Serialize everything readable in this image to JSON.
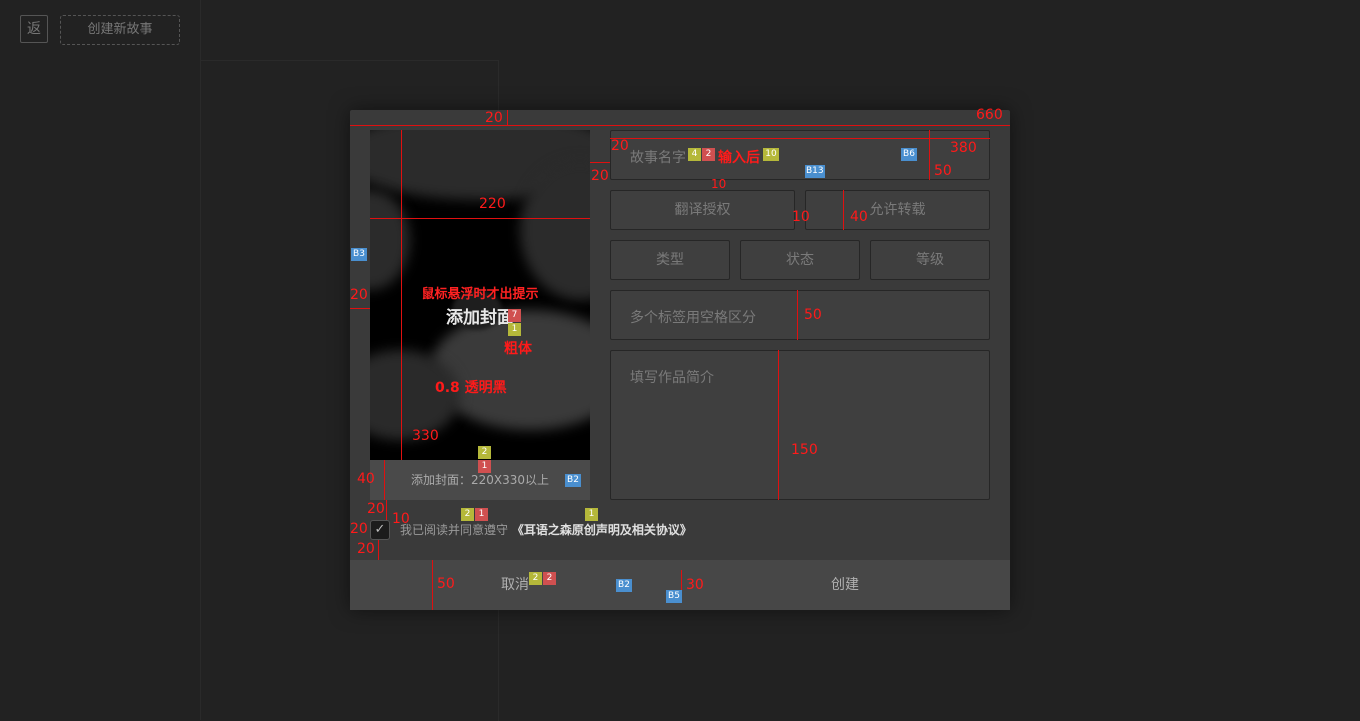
{
  "background": {
    "back_label": "返",
    "create_story_label": "创建新故事"
  },
  "dialog": {
    "cover": {
      "hover_hint": "鼠标悬浮时才出提示",
      "add_label": "添加封面",
      "footer_text": "添加封面：220X330以上"
    },
    "story_name_placeholder": "故事名字",
    "translation_label": "翻译授权",
    "repost_label": "允许转载",
    "type_label": "类型",
    "status_label": "状态",
    "level_label": "等级",
    "tags_placeholder": "多个标签用空格区分",
    "intro_placeholder": "填写作品简介",
    "agree_text": "我已阅读并同意遵守",
    "agree_link": "《耳语之森原创声明及相关协议》",
    "cancel_label": "取消",
    "create_label": "创建"
  },
  "annotations": {
    "dialog_width": "660",
    "top_margin": "20",
    "cover_width": "220",
    "cover_height": "330",
    "left_margin": "20",
    "opacity_note": "0.8 透明黑",
    "bold_note": "粗体",
    "after_input_note": "输入后",
    "field_width": "380",
    "field_height": "50",
    "gap_20": "20",
    "gap_10": "10",
    "btn_height": "40",
    "tags_height": "50",
    "intro_height": "150",
    "footer_left_height": "40",
    "check_gap_20a": "20",
    "check_gap_10": "10",
    "check_gap_20b": "20",
    "check_gap_20c": "20",
    "footer_height": "50",
    "footer_gap": "30",
    "badge_4": "4",
    "badge_2": "2",
    "badge_10": "10",
    "badge_b6": "B6",
    "badge_b13": "B13",
    "badge_b3": "B3",
    "badge_7": "7",
    "badge_1": "1",
    "badge_c2": "2",
    "badge_c1": "1",
    "badge_b2": "B2",
    "badge_a2": "2",
    "badge_a1": "1",
    "badge_l1": "1",
    "badge_f2": "2",
    "badge_f2b": "2",
    "badge_fb2": "B2",
    "badge_b5": "B5"
  },
  "colors": {
    "page_bg": "#222222",
    "dialog_bg": "#3a3a3a",
    "annotation_red": "#ff1a1a"
  }
}
